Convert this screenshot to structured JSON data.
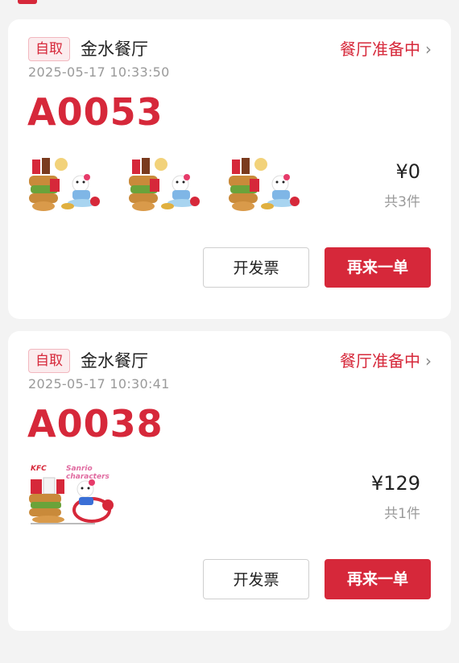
{
  "colors": {
    "accent": "#d6283a",
    "muted": "#9a9a9a",
    "text": "#222222"
  },
  "orders": [
    {
      "badge": "自取",
      "store": "金水餐厅",
      "status": "餐厅准备中",
      "timestamp": "2025-05-17 10:33:50",
      "order_number": "A0053",
      "price": "¥0",
      "count": "共3件",
      "invoice_label": "开发票",
      "reorder_label": "再来一单",
      "thumbnails": [
        "kfc-hello-kitty-meal-image",
        "kfc-hello-kitty-meal-image",
        "kfc-hello-kitty-meal-image"
      ]
    },
    {
      "badge": "自取",
      "store": "金水餐厅",
      "status": "餐厅准备中",
      "timestamp": "2025-05-17 10:30:41",
      "order_number": "A0038",
      "price": "¥129",
      "count": "共1件",
      "invoice_label": "开发票",
      "reorder_label": "再来一单",
      "thumbnails": [
        "kfc-sanrio-meal-image"
      ],
      "thumbnail_text": [
        "KFC",
        "Sanrio characters"
      ]
    }
  ]
}
